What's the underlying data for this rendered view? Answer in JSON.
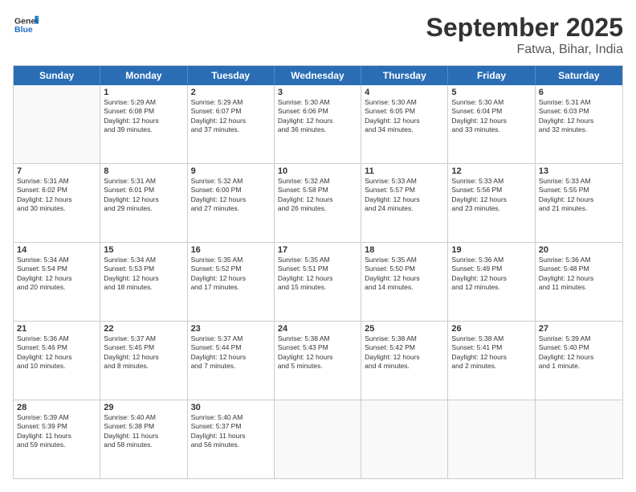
{
  "logo": {
    "line1": "General",
    "line2": "Blue"
  },
  "title": "September 2025",
  "subtitle": "Fatwa, Bihar, India",
  "days": [
    "Sunday",
    "Monday",
    "Tuesday",
    "Wednesday",
    "Thursday",
    "Friday",
    "Saturday"
  ],
  "weeks": [
    [
      {
        "day": "",
        "text": ""
      },
      {
        "day": "1",
        "text": "Sunrise: 5:29 AM\nSunset: 6:08 PM\nDaylight: 12 hours\nand 39 minutes."
      },
      {
        "day": "2",
        "text": "Sunrise: 5:29 AM\nSunset: 6:07 PM\nDaylight: 12 hours\nand 37 minutes."
      },
      {
        "day": "3",
        "text": "Sunrise: 5:30 AM\nSunset: 6:06 PM\nDaylight: 12 hours\nand 36 minutes."
      },
      {
        "day": "4",
        "text": "Sunrise: 5:30 AM\nSunset: 6:05 PM\nDaylight: 12 hours\nand 34 minutes."
      },
      {
        "day": "5",
        "text": "Sunrise: 5:30 AM\nSunset: 6:04 PM\nDaylight: 12 hours\nand 33 minutes."
      },
      {
        "day": "6",
        "text": "Sunrise: 5:31 AM\nSunset: 6:03 PM\nDaylight: 12 hours\nand 32 minutes."
      }
    ],
    [
      {
        "day": "7",
        "text": "Sunrise: 5:31 AM\nSunset: 6:02 PM\nDaylight: 12 hours\nand 30 minutes."
      },
      {
        "day": "8",
        "text": "Sunrise: 5:31 AM\nSunset: 6:01 PM\nDaylight: 12 hours\nand 29 minutes."
      },
      {
        "day": "9",
        "text": "Sunrise: 5:32 AM\nSunset: 6:00 PM\nDaylight: 12 hours\nand 27 minutes."
      },
      {
        "day": "10",
        "text": "Sunrise: 5:32 AM\nSunset: 5:58 PM\nDaylight: 12 hours\nand 26 minutes."
      },
      {
        "day": "11",
        "text": "Sunrise: 5:33 AM\nSunset: 5:57 PM\nDaylight: 12 hours\nand 24 minutes."
      },
      {
        "day": "12",
        "text": "Sunrise: 5:33 AM\nSunset: 5:56 PM\nDaylight: 12 hours\nand 23 minutes."
      },
      {
        "day": "13",
        "text": "Sunrise: 5:33 AM\nSunset: 5:55 PM\nDaylight: 12 hours\nand 21 minutes."
      }
    ],
    [
      {
        "day": "14",
        "text": "Sunrise: 5:34 AM\nSunset: 5:54 PM\nDaylight: 12 hours\nand 20 minutes."
      },
      {
        "day": "15",
        "text": "Sunrise: 5:34 AM\nSunset: 5:53 PM\nDaylight: 12 hours\nand 18 minutes."
      },
      {
        "day": "16",
        "text": "Sunrise: 5:35 AM\nSunset: 5:52 PM\nDaylight: 12 hours\nand 17 minutes."
      },
      {
        "day": "17",
        "text": "Sunrise: 5:35 AM\nSunset: 5:51 PM\nDaylight: 12 hours\nand 15 minutes."
      },
      {
        "day": "18",
        "text": "Sunrise: 5:35 AM\nSunset: 5:50 PM\nDaylight: 12 hours\nand 14 minutes."
      },
      {
        "day": "19",
        "text": "Sunrise: 5:36 AM\nSunset: 5:49 PM\nDaylight: 12 hours\nand 12 minutes."
      },
      {
        "day": "20",
        "text": "Sunrise: 5:36 AM\nSunset: 5:48 PM\nDaylight: 12 hours\nand 11 minutes."
      }
    ],
    [
      {
        "day": "21",
        "text": "Sunrise: 5:36 AM\nSunset: 5:46 PM\nDaylight: 12 hours\nand 10 minutes."
      },
      {
        "day": "22",
        "text": "Sunrise: 5:37 AM\nSunset: 5:45 PM\nDaylight: 12 hours\nand 8 minutes."
      },
      {
        "day": "23",
        "text": "Sunrise: 5:37 AM\nSunset: 5:44 PM\nDaylight: 12 hours\nand 7 minutes."
      },
      {
        "day": "24",
        "text": "Sunrise: 5:38 AM\nSunset: 5:43 PM\nDaylight: 12 hours\nand 5 minutes."
      },
      {
        "day": "25",
        "text": "Sunrise: 5:38 AM\nSunset: 5:42 PM\nDaylight: 12 hours\nand 4 minutes."
      },
      {
        "day": "26",
        "text": "Sunrise: 5:38 AM\nSunset: 5:41 PM\nDaylight: 12 hours\nand 2 minutes."
      },
      {
        "day": "27",
        "text": "Sunrise: 5:39 AM\nSunset: 5:40 PM\nDaylight: 12 hours\nand 1 minute."
      }
    ],
    [
      {
        "day": "28",
        "text": "Sunrise: 5:39 AM\nSunset: 5:39 PM\nDaylight: 11 hours\nand 59 minutes."
      },
      {
        "day": "29",
        "text": "Sunrise: 5:40 AM\nSunset: 5:38 PM\nDaylight: 11 hours\nand 58 minutes."
      },
      {
        "day": "30",
        "text": "Sunrise: 5:40 AM\nSunset: 5:37 PM\nDaylight: 11 hours\nand 56 minutes."
      },
      {
        "day": "",
        "text": ""
      },
      {
        "day": "",
        "text": ""
      },
      {
        "day": "",
        "text": ""
      },
      {
        "day": "",
        "text": ""
      }
    ]
  ]
}
